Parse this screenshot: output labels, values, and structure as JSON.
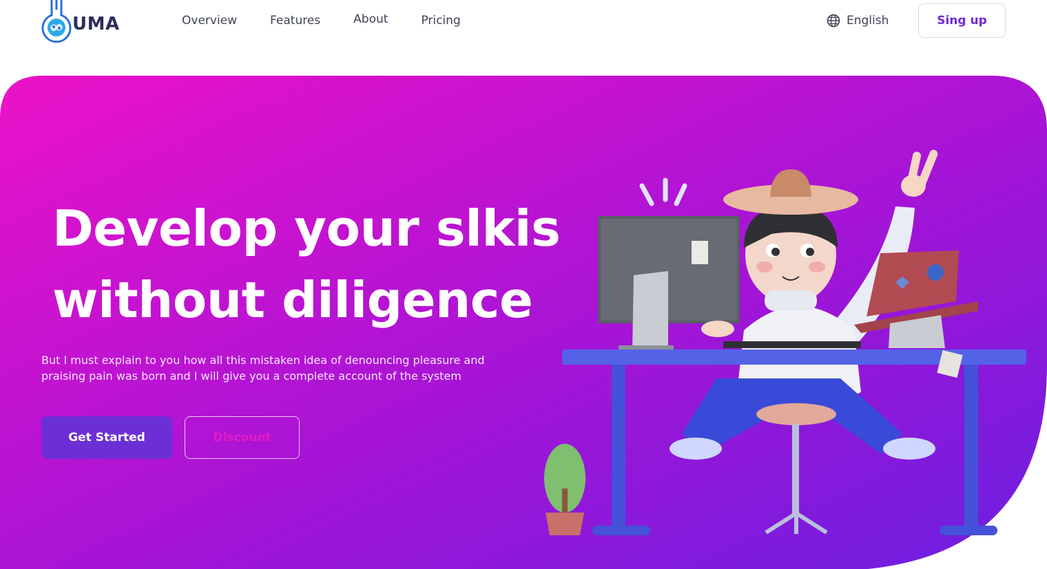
{
  "brand": {
    "name": "UMA",
    "logo_icon": "flask-brain-icon"
  },
  "nav": {
    "items": [
      {
        "label": "Overview"
      },
      {
        "label": "Features"
      },
      {
        "label": "About"
      },
      {
        "label": "Pricing"
      }
    ]
  },
  "language": {
    "label": "English",
    "icon": "globe-icon"
  },
  "signup": {
    "label": "Sing up"
  },
  "hero": {
    "title_line1": "Develop your slkis",
    "title_line2": "without diligence",
    "description": "But I must explain to you how all this mistaken idea of denouncing pleasure and praising pain was born and I will give you a complete account of the system",
    "primary_button": "Get Started",
    "secondary_button": "Discount"
  },
  "colors": {
    "gradient_start": "#ec12c8",
    "gradient_end": "#6b1fe0",
    "primary_button": "#6c2fd6",
    "signup_text": "#6e2bd9",
    "logo_text": "#2a2f5b"
  },
  "illustration": {
    "name": "person-at-desk-illustration"
  }
}
